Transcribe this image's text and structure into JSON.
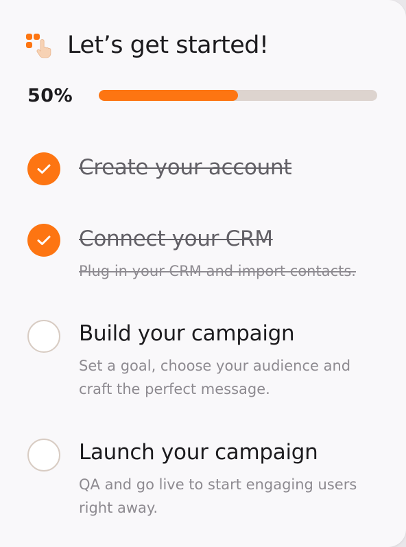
{
  "header": {
    "title": "Let’s get started!",
    "icon": "hand-pointer-icon"
  },
  "progress": {
    "label": "50%",
    "value": 0.5,
    "fill_color": "#fd7512",
    "track_color": "#ddd4cf"
  },
  "colors": {
    "accent": "#fd7512",
    "pending_ring": "#d8ccc3"
  },
  "steps": [
    {
      "title": "Create your account",
      "description": "",
      "completed": true,
      "icon": "check-icon"
    },
    {
      "title": "Connect your CRM",
      "description": "Plug in your CRM and import contacts.",
      "completed": true,
      "icon": "check-icon"
    },
    {
      "title": "Build your campaign",
      "description": "Set a goal, choose your audience and craft the perfect message.",
      "completed": false,
      "icon": "empty-circle-icon"
    },
    {
      "title": "Launch your campaign",
      "description": "QA and go live to start engaging users right away.",
      "completed": false,
      "icon": "empty-circle-icon"
    }
  ]
}
